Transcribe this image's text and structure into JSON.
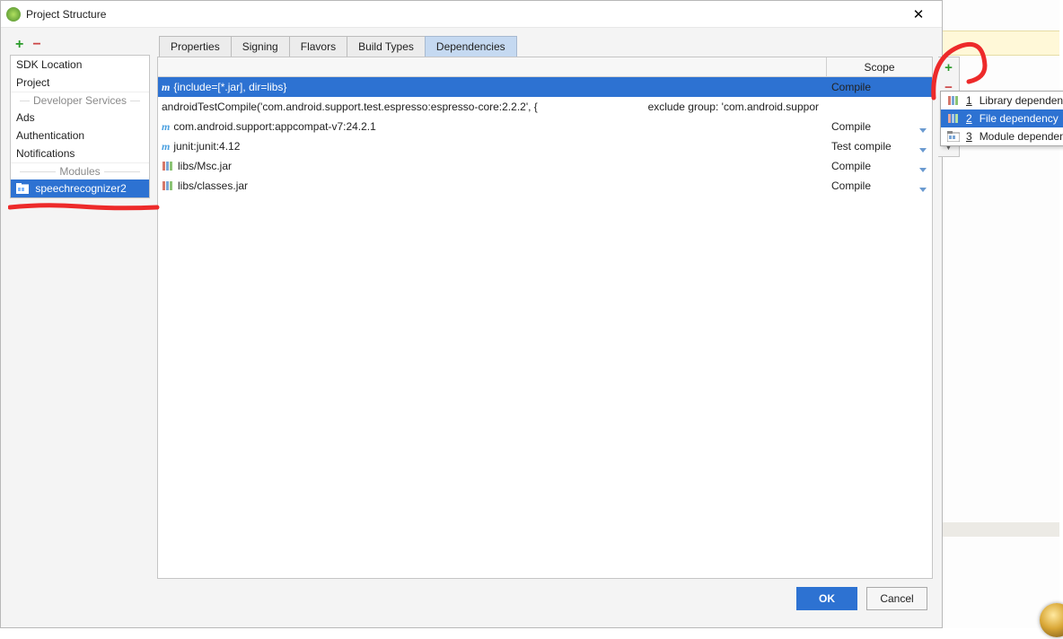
{
  "window": {
    "title": "Project Structure"
  },
  "sidebar": {
    "items": [
      {
        "label": "SDK Location",
        "type": "item"
      },
      {
        "label": "Project",
        "type": "item"
      },
      {
        "label": "Developer Services",
        "type": "header"
      },
      {
        "label": "Ads",
        "type": "item"
      },
      {
        "label": "Authentication",
        "type": "item"
      },
      {
        "label": "Notifications",
        "type": "item"
      },
      {
        "label": "Modules",
        "type": "header"
      },
      {
        "label": "speechrecognizer2",
        "type": "module",
        "selected": true
      }
    ]
  },
  "tabs": [
    {
      "label": "Properties"
    },
    {
      "label": "Signing"
    },
    {
      "label": "Flavors"
    },
    {
      "label": "Build Types"
    },
    {
      "label": "Dependencies",
      "active": true
    }
  ],
  "grid": {
    "scope_header": "Scope",
    "rows": [
      {
        "icon": "m",
        "text": "{include=[*.jar], dir=libs}",
        "scope": "Compile",
        "selected": true
      },
      {
        "icon": "",
        "text": "androidTestCompile('com.android.support.test.espresso:espresso-core:2.2.2', {",
        "extra": "exclude group: 'com.android.suppor",
        "scope": ""
      },
      {
        "icon": "m",
        "text": "com.android.support:appcompat-v7:24.2.1",
        "scope": "Compile"
      },
      {
        "icon": "m",
        "text": "junit:junit:4.12",
        "scope": "Test compile"
      },
      {
        "icon": "lib",
        "text": "libs/Msc.jar",
        "scope": "Compile"
      },
      {
        "icon": "lib",
        "text": "libs/classes.jar",
        "scope": "Compile"
      }
    ]
  },
  "popup": {
    "items": [
      {
        "key": "1",
        "label": "Library dependency",
        "icon": "lib"
      },
      {
        "key": "2",
        "label": "File dependency",
        "icon": "lib",
        "selected": true
      },
      {
        "key": "3",
        "label": "Module dependency",
        "icon": "mod"
      }
    ]
  },
  "buttons": {
    "ok": "OK",
    "cancel": "Cancel"
  }
}
